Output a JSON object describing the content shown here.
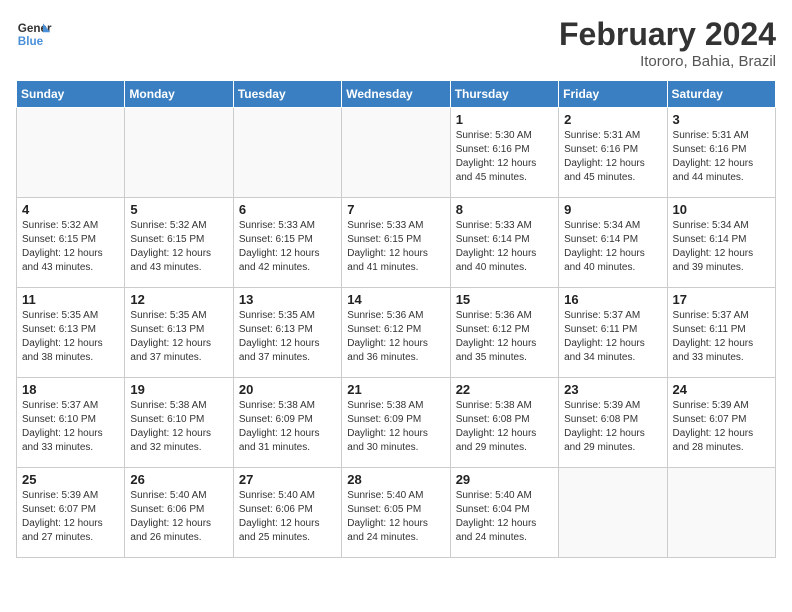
{
  "header": {
    "logo_general": "General",
    "logo_blue": "Blue",
    "month_title": "February 2024",
    "location": "Itororo, Bahia, Brazil"
  },
  "days_of_week": [
    "Sunday",
    "Monday",
    "Tuesday",
    "Wednesday",
    "Thursday",
    "Friday",
    "Saturday"
  ],
  "weeks": [
    [
      {
        "day": "",
        "info": ""
      },
      {
        "day": "",
        "info": ""
      },
      {
        "day": "",
        "info": ""
      },
      {
        "day": "",
        "info": ""
      },
      {
        "day": "1",
        "info": "Sunrise: 5:30 AM\nSunset: 6:16 PM\nDaylight: 12 hours\nand 45 minutes."
      },
      {
        "day": "2",
        "info": "Sunrise: 5:31 AM\nSunset: 6:16 PM\nDaylight: 12 hours\nand 45 minutes."
      },
      {
        "day": "3",
        "info": "Sunrise: 5:31 AM\nSunset: 6:16 PM\nDaylight: 12 hours\nand 44 minutes."
      }
    ],
    [
      {
        "day": "4",
        "info": "Sunrise: 5:32 AM\nSunset: 6:15 PM\nDaylight: 12 hours\nand 43 minutes."
      },
      {
        "day": "5",
        "info": "Sunrise: 5:32 AM\nSunset: 6:15 PM\nDaylight: 12 hours\nand 43 minutes."
      },
      {
        "day": "6",
        "info": "Sunrise: 5:33 AM\nSunset: 6:15 PM\nDaylight: 12 hours\nand 42 minutes."
      },
      {
        "day": "7",
        "info": "Sunrise: 5:33 AM\nSunset: 6:15 PM\nDaylight: 12 hours\nand 41 minutes."
      },
      {
        "day": "8",
        "info": "Sunrise: 5:33 AM\nSunset: 6:14 PM\nDaylight: 12 hours\nand 40 minutes."
      },
      {
        "day": "9",
        "info": "Sunrise: 5:34 AM\nSunset: 6:14 PM\nDaylight: 12 hours\nand 40 minutes."
      },
      {
        "day": "10",
        "info": "Sunrise: 5:34 AM\nSunset: 6:14 PM\nDaylight: 12 hours\nand 39 minutes."
      }
    ],
    [
      {
        "day": "11",
        "info": "Sunrise: 5:35 AM\nSunset: 6:13 PM\nDaylight: 12 hours\nand 38 minutes."
      },
      {
        "day": "12",
        "info": "Sunrise: 5:35 AM\nSunset: 6:13 PM\nDaylight: 12 hours\nand 37 minutes."
      },
      {
        "day": "13",
        "info": "Sunrise: 5:35 AM\nSunset: 6:13 PM\nDaylight: 12 hours\nand 37 minutes."
      },
      {
        "day": "14",
        "info": "Sunrise: 5:36 AM\nSunset: 6:12 PM\nDaylight: 12 hours\nand 36 minutes."
      },
      {
        "day": "15",
        "info": "Sunrise: 5:36 AM\nSunset: 6:12 PM\nDaylight: 12 hours\nand 35 minutes."
      },
      {
        "day": "16",
        "info": "Sunrise: 5:37 AM\nSunset: 6:11 PM\nDaylight: 12 hours\nand 34 minutes."
      },
      {
        "day": "17",
        "info": "Sunrise: 5:37 AM\nSunset: 6:11 PM\nDaylight: 12 hours\nand 33 minutes."
      }
    ],
    [
      {
        "day": "18",
        "info": "Sunrise: 5:37 AM\nSunset: 6:10 PM\nDaylight: 12 hours\nand 33 minutes."
      },
      {
        "day": "19",
        "info": "Sunrise: 5:38 AM\nSunset: 6:10 PM\nDaylight: 12 hours\nand 32 minutes."
      },
      {
        "day": "20",
        "info": "Sunrise: 5:38 AM\nSunset: 6:09 PM\nDaylight: 12 hours\nand 31 minutes."
      },
      {
        "day": "21",
        "info": "Sunrise: 5:38 AM\nSunset: 6:09 PM\nDaylight: 12 hours\nand 30 minutes."
      },
      {
        "day": "22",
        "info": "Sunrise: 5:38 AM\nSunset: 6:08 PM\nDaylight: 12 hours\nand 29 minutes."
      },
      {
        "day": "23",
        "info": "Sunrise: 5:39 AM\nSunset: 6:08 PM\nDaylight: 12 hours\nand 29 minutes."
      },
      {
        "day": "24",
        "info": "Sunrise: 5:39 AM\nSunset: 6:07 PM\nDaylight: 12 hours\nand 28 minutes."
      }
    ],
    [
      {
        "day": "25",
        "info": "Sunrise: 5:39 AM\nSunset: 6:07 PM\nDaylight: 12 hours\nand 27 minutes."
      },
      {
        "day": "26",
        "info": "Sunrise: 5:40 AM\nSunset: 6:06 PM\nDaylight: 12 hours\nand 26 minutes."
      },
      {
        "day": "27",
        "info": "Sunrise: 5:40 AM\nSunset: 6:06 PM\nDaylight: 12 hours\nand 25 minutes."
      },
      {
        "day": "28",
        "info": "Sunrise: 5:40 AM\nSunset: 6:05 PM\nDaylight: 12 hours\nand 24 minutes."
      },
      {
        "day": "29",
        "info": "Sunrise: 5:40 AM\nSunset: 6:04 PM\nDaylight: 12 hours\nand 24 minutes."
      },
      {
        "day": "",
        "info": ""
      },
      {
        "day": "",
        "info": ""
      }
    ]
  ]
}
